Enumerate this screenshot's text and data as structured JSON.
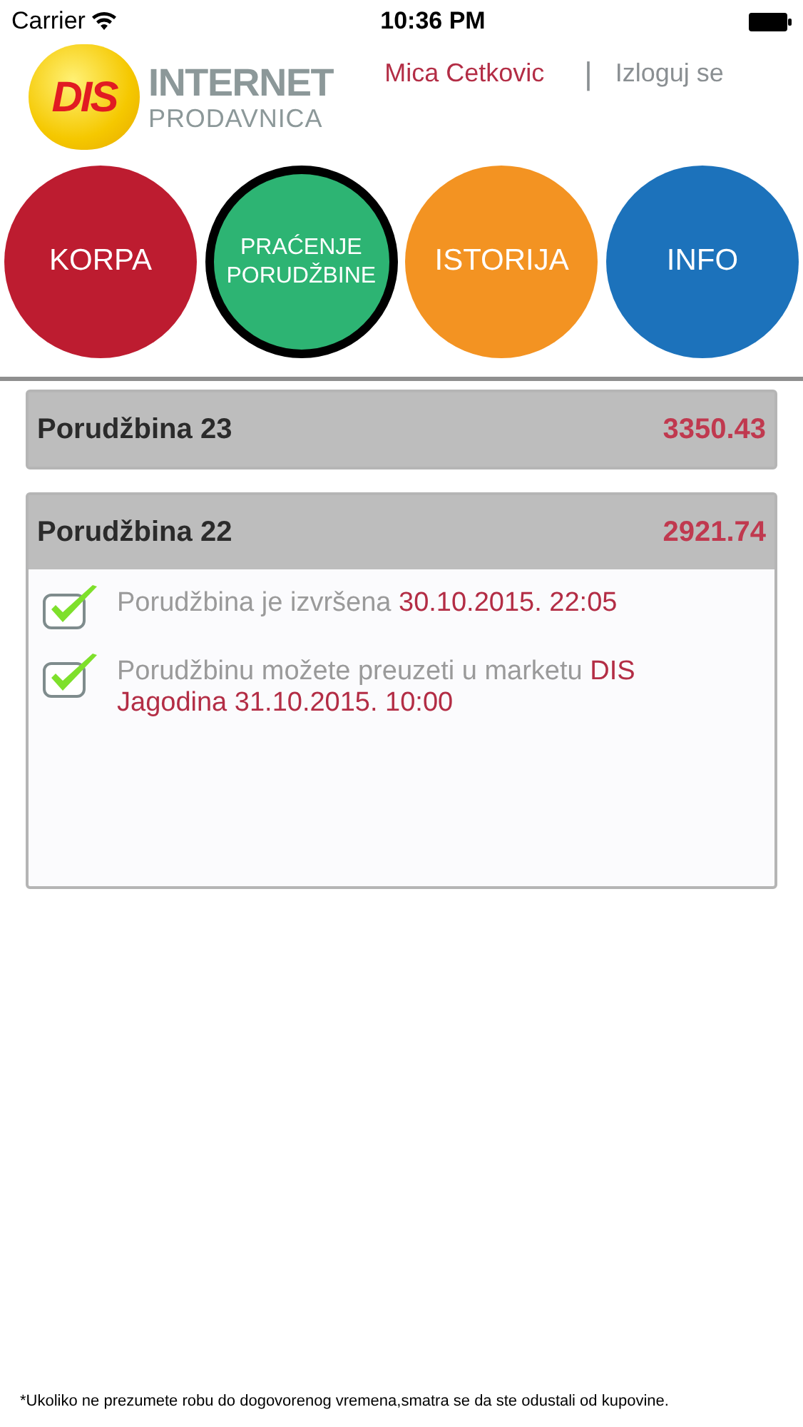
{
  "status_bar": {
    "carrier": "Carrier",
    "time": "10:36 PM"
  },
  "header": {
    "logo": {
      "badge": "DIS",
      "line1": "INTERNET",
      "line2": "PRODAVNICA"
    },
    "user": "Mica Cetkovic",
    "separator": "|",
    "logout": "Izloguj se"
  },
  "nav": [
    {
      "label": "KORPA",
      "color": "#bd1c30",
      "selected": false
    },
    {
      "label": "PRAĆENJE PORUDŽBINE",
      "color": "#2db473",
      "selected": true
    },
    {
      "label": "ISTORIJA",
      "color": "#f39322",
      "selected": false
    },
    {
      "label": "INFO",
      "color": "#1c72bb",
      "selected": false
    }
  ],
  "orders": [
    {
      "title": "Porudžbina 23",
      "total": "3350.43",
      "expanded": false
    },
    {
      "title": "Porudžbina 22",
      "total": "2921.74",
      "expanded": true,
      "steps": [
        {
          "text": "Porudžbina je izvršena",
          "detail": "30.10.2015. 22:05",
          "checked": true
        },
        {
          "text": "Porudžbinu možete preuzeti u marketu",
          "detail": "DIS Jagodina 31.10.2015. 10:00",
          "checked": true
        }
      ]
    }
  ],
  "footnote": "*Ukoliko ne prezumete robu do dogovorenog vremena,smatra se da ste odustali od kupovine."
}
